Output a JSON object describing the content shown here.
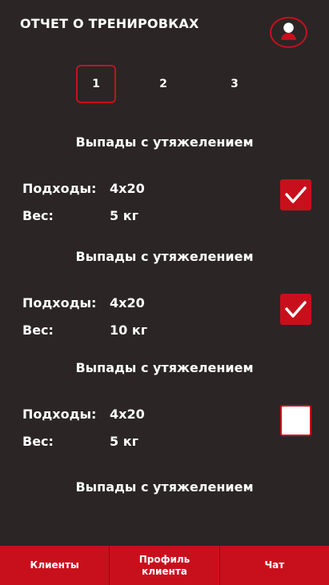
{
  "header": {
    "title": "ОТЧЕТ О ТРЕНИРОВКАХ",
    "avatar_icon": "user-avatar-icon"
  },
  "pagination": {
    "pages": [
      "1",
      "2",
      "3"
    ],
    "active": "1"
  },
  "labels": {
    "sets": "Подходы:",
    "weight": "Вес:"
  },
  "exercises": [
    {
      "name": "Выпады с утяжелением",
      "sets": "4x20",
      "weight": "5 кг",
      "done": true
    },
    {
      "name": "Выпады с утяжелением",
      "sets": "4x20",
      "weight": "10 кг",
      "done": true
    },
    {
      "name": "Выпады с утяжелением",
      "sets": "4x20",
      "weight": "5 кг",
      "done": false
    },
    {
      "name": "Выпады с утяжелением"
    }
  ],
  "bottom_nav": {
    "items": [
      "Клиенты",
      "Профиль клиента",
      "Чат"
    ]
  },
  "colors": {
    "background": "#2b2526",
    "accent": "#c8101c",
    "text": "#ffffff"
  }
}
